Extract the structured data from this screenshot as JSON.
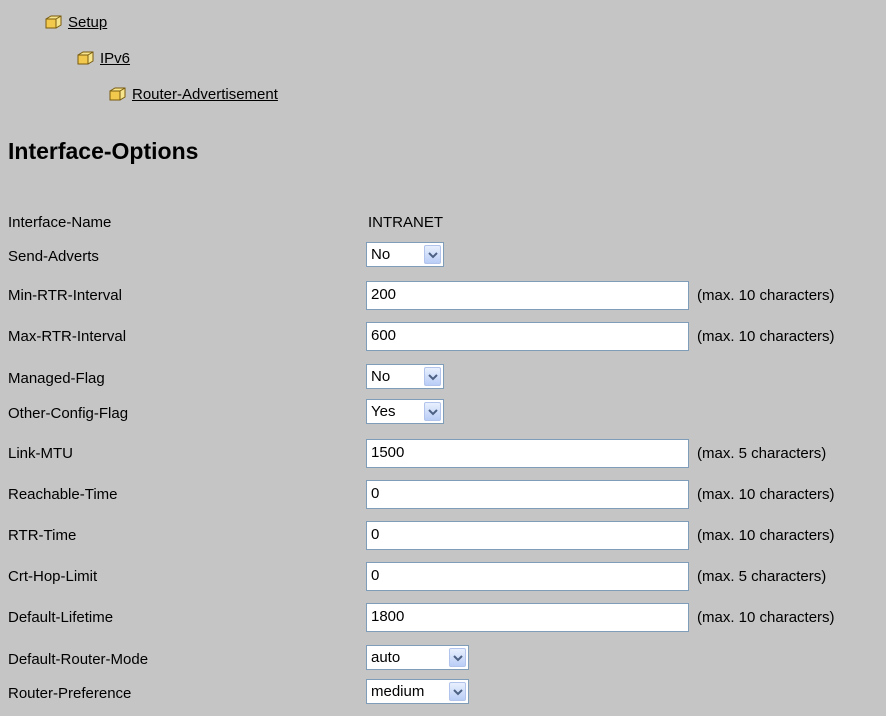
{
  "breadcrumb": [
    {
      "label": "Setup"
    },
    {
      "label": "IPv6"
    },
    {
      "label": "Router-Advertisement"
    }
  ],
  "title": "Interface-Options",
  "fields": {
    "interface_name": {
      "label": "Interface-Name",
      "value": "INTRANET"
    },
    "send_adverts": {
      "label": "Send-Adverts",
      "value": "No"
    },
    "min_rtr_interval": {
      "label": "Min-RTR-Interval",
      "value": "200",
      "hint": "(max. 10 characters)"
    },
    "max_rtr_interval": {
      "label": "Max-RTR-Interval",
      "value": "600",
      "hint": "(max. 10 characters)"
    },
    "managed_flag": {
      "label": "Managed-Flag",
      "value": "No"
    },
    "other_config_flag": {
      "label": "Other-Config-Flag",
      "value": "Yes"
    },
    "link_mtu": {
      "label": "Link-MTU",
      "value": "1500",
      "hint": "(max. 5 characters)"
    },
    "reachable_time": {
      "label": "Reachable-Time",
      "value": "0",
      "hint": "(max. 10 characters)"
    },
    "rtr_time": {
      "label": "RTR-Time",
      "value": "0",
      "hint": "(max. 10 characters)"
    },
    "crt_hop_limit": {
      "label": "Crt-Hop-Limit",
      "value": "0",
      "hint": "(max. 5 characters)"
    },
    "default_lifetime": {
      "label": "Default-Lifetime",
      "value": "1800",
      "hint": "(max. 10 characters)"
    },
    "default_router_mode": {
      "label": "Default-Router-Mode",
      "value": "auto"
    },
    "router_preference": {
      "label": "Router-Preference",
      "value": "medium"
    }
  }
}
